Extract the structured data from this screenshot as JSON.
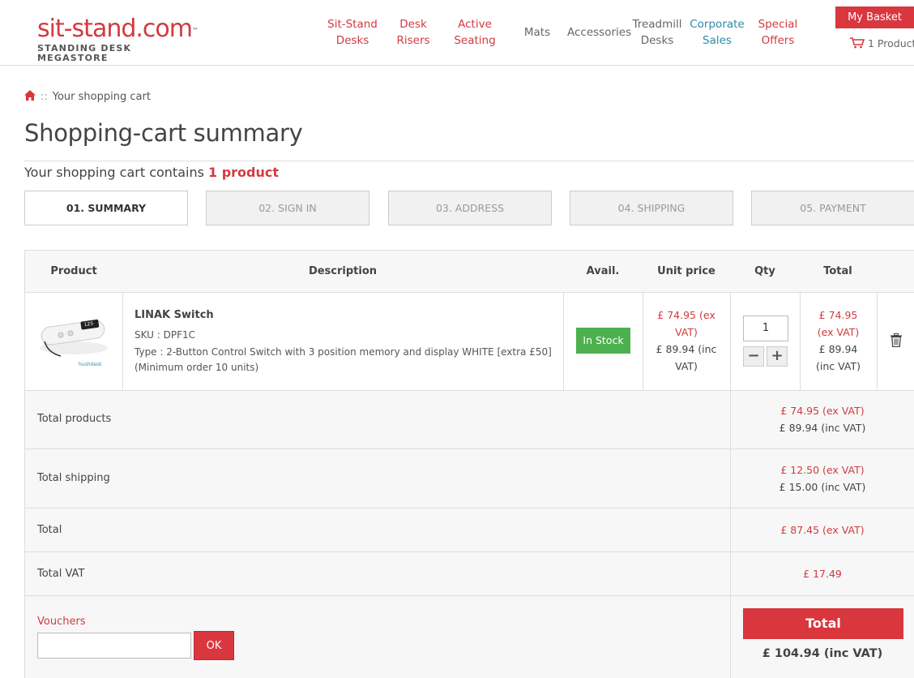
{
  "header": {
    "logo_main": "sit-stand.com",
    "logo_tm": "™",
    "logo_sub": "STANDING DESK MEGASTORE",
    "nav": [
      {
        "line1": "Sit-Stand",
        "line2": "Desks"
      },
      {
        "line1": "Desk",
        "line2": "Risers"
      },
      {
        "line1": "Active",
        "line2": "Seating"
      },
      {
        "line1": "Mats",
        "line2": ""
      },
      {
        "line1": "Accessories",
        "line2": ""
      },
      {
        "line1": "Treadmill",
        "line2": "Desks"
      },
      {
        "line1": "Corporate",
        "line2": "Sales"
      },
      {
        "line1": "Special",
        "line2": "Offers"
      }
    ],
    "basket_label": "My Basket",
    "basket_count": "1 Product"
  },
  "breadcrumb": {
    "separator": "::",
    "current": "Your shopping cart"
  },
  "page_title": "Shopping-cart summary",
  "contains": {
    "prefix": "Your shopping cart contains ",
    "count": "1 product"
  },
  "steps": [
    {
      "label": "01. SUMMARY",
      "active": true
    },
    {
      "label": "02. SIGN IN",
      "active": false
    },
    {
      "label": "03. ADDRESS",
      "active": false
    },
    {
      "label": "04. SHIPPING",
      "active": false
    },
    {
      "label": "05. PAYMENT",
      "active": false
    }
  ],
  "table": {
    "headers": {
      "product": "Product",
      "description": "Description",
      "avail": "Avail.",
      "unit_price": "Unit price",
      "qty": "Qty",
      "total": "Total"
    },
    "item": {
      "name": "LINAK Switch",
      "sku": "SKU : DPF1C",
      "type": "Type : 2-Button Control Switch with 3 position memory and display WHITE [extra £50] (Minimum order 10 units)",
      "thumb_brand": "hushdesk",
      "thumb_display": "125",
      "availability": "In Stock",
      "unit_price_ex_1": "£ 74.95 (ex",
      "unit_price_ex_2": "VAT)",
      "unit_price_inc_1": "£ 89.94 (inc",
      "unit_price_inc_2": "VAT)",
      "qty": "1",
      "qty_minus": "−",
      "qty_plus": "+",
      "total_ex_1": "£ 74.95",
      "total_ex_2": "(ex VAT)",
      "total_inc_1": "£ 89.94",
      "total_inc_2": "(inc VAT)"
    },
    "summary": {
      "total_products_label": "Total products",
      "total_products_ex": "£ 74.95 (ex VAT)",
      "total_products_inc": "£ 89.94 (inc VAT)",
      "total_shipping_label": "Total shipping",
      "total_shipping_ex": "£ 12.50 (ex VAT)",
      "total_shipping_inc": "£ 15.00 (inc VAT)",
      "total_label": "Total",
      "total_ex": "£ 87.45 (ex VAT)",
      "total_vat_label": "Total VAT",
      "total_vat": "£ 17.49",
      "vouchers_label": "Vouchers",
      "voucher_placeholder": "",
      "ok_label": "OK",
      "grand_total_label": "Total",
      "grand_total": "£ 104.94 (inc VAT)"
    }
  },
  "colors": {
    "brand_red": "#d9363e",
    "stock_green": "#4cb04f",
    "link_teal": "#2e8aa8"
  }
}
